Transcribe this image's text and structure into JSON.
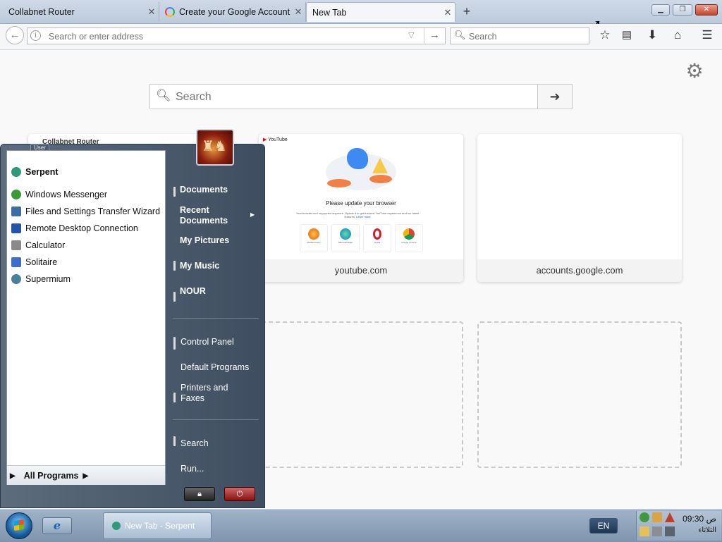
{
  "tabs": [
    {
      "label": "Collabnet Router",
      "active": false
    },
    {
      "label": "Create your Google Account",
      "active": false
    },
    {
      "label": "New Tab",
      "active": true
    }
  ],
  "navbar": {
    "address_placeholder": "Search or enter address",
    "search_placeholder": "Search"
  },
  "page": {
    "search_placeholder": "Search",
    "tiles": [
      {
        "label": "youtube.com",
        "preview_heading": "Please update your browser",
        "preview_text": "Your browser isn't supported anymore. Update it to get the best YouTube experience and our latest features.",
        "preview_link": "Learn more",
        "brand": "YouTube",
        "browsers": [
          "Mozilla Firefox",
          "Microsoft Edge",
          "Opera",
          "Google Chrome"
        ]
      },
      {
        "label": "accounts.google.com"
      }
    ],
    "partial_tile_title": "Collabnet Router"
  },
  "start_menu": {
    "user_tag": "User",
    "pinned": "Serpent",
    "programs": [
      {
        "label": "Windows Messenger",
        "color": "#3a9a3a"
      },
      {
        "label": "Files and Settings Transfer Wizard",
        "color": "#3a6ea5"
      },
      {
        "label": "Remote Desktop Connection",
        "color": "#2255aa"
      },
      {
        "label": "Calculator",
        "color": "#8a8a8a"
      },
      {
        "label": "Solitaire",
        "color": "#3d6ec9"
      },
      {
        "label": "Supermium",
        "color": "#4a7f9a"
      }
    ],
    "all_programs": "All Programs",
    "places": [
      {
        "label": "Documents",
        "bold": true
      },
      {
        "label": "Recent Documents",
        "bold": true
      },
      {
        "label": "My Pictures",
        "bold": true
      },
      {
        "label": "My Music",
        "bold": true
      },
      {
        "label": "NOUR",
        "bold": true
      },
      {
        "label": "Control Panel",
        "bold": false
      },
      {
        "label": "Default Programs",
        "bold": false
      },
      {
        "label": "Printers and Faxes",
        "bold": false
      },
      {
        "label": "Search",
        "bold": false
      },
      {
        "label": "Run...",
        "bold": false
      }
    ]
  },
  "taskbar": {
    "active_task": "New Tab - Serpent",
    "language": "EN",
    "time": "09:30 ص",
    "day": "الثلاثاء"
  },
  "colors": {
    "taskbar": "#8ea4bb",
    "start_menu": "#4e5e70",
    "accent": "#0a84ff"
  }
}
